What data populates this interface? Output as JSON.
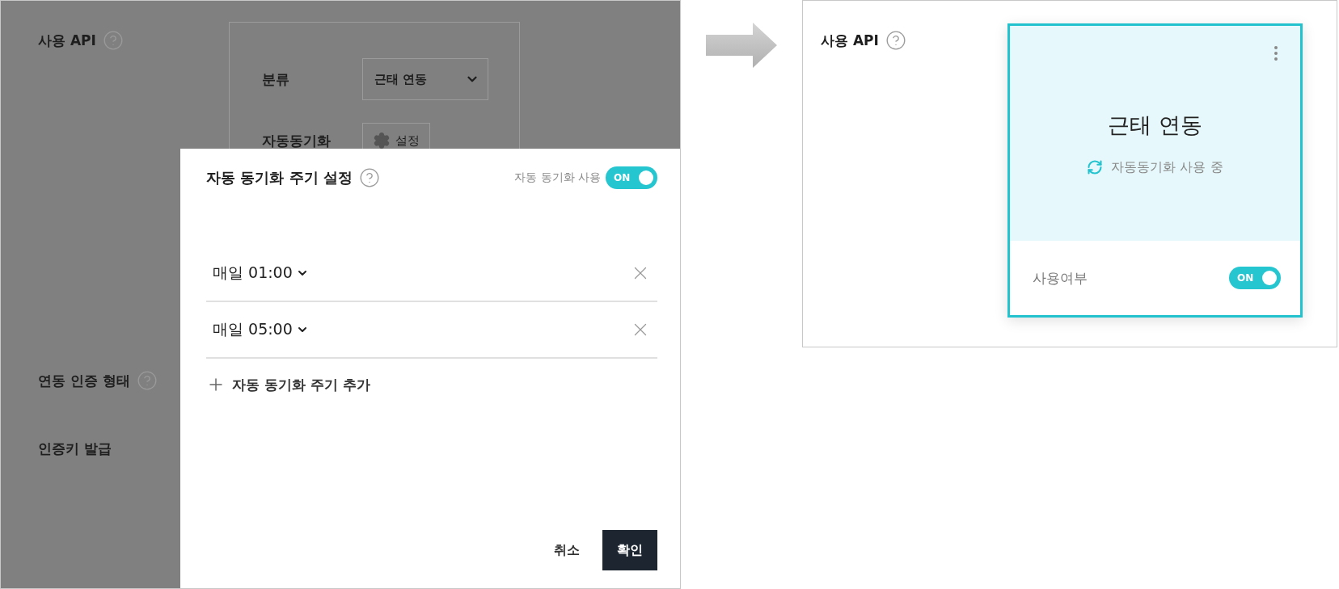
{
  "before": {
    "fields": [
      {
        "label": "사용 API",
        "help": true
      },
      {
        "label": "연동 인증 형태",
        "help": true
      },
      {
        "label": "인증키 발급",
        "help": false
      }
    ],
    "settings": {
      "category_label": "분류",
      "category_value": "근태 연동",
      "sync_label": "자동동기화",
      "sync_button": "설정"
    },
    "modal": {
      "title": "자동 동기화 주기 설정",
      "toggle_label": "자동 동기화 사용",
      "toggle": {
        "on": true,
        "text": "ON"
      },
      "schedules": [
        {
          "text": "매일 01:00"
        },
        {
          "text": "매일 05:00"
        }
      ],
      "add": "자동 동기화 주기 추가",
      "cancel": "취소",
      "confirm": "확인"
    }
  },
  "after": {
    "label": "사용 API",
    "help": true,
    "card": {
      "title": "근태 연동",
      "status": "자동동기화 사용 중",
      "footer_label": "사용여부",
      "toggle": {
        "on": true,
        "text": "ON"
      }
    }
  }
}
